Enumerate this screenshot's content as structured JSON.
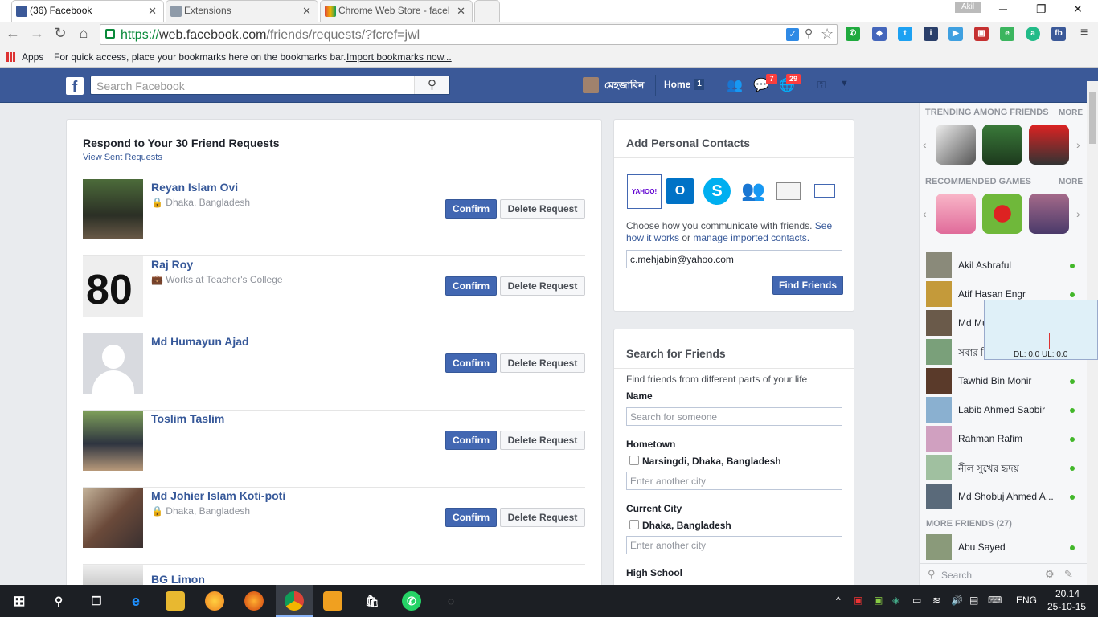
{
  "browser": {
    "tabs": [
      {
        "label": "(36) Facebook",
        "icon": "facebook-icon",
        "active": true
      },
      {
        "label": "Extensions",
        "icon": "puzzle-icon",
        "active": false
      },
      {
        "label": "Chrome Web Store - facel",
        "icon": "chrome-store-icon",
        "active": false
      }
    ],
    "profile_name": "Akil",
    "url_scheme": "https://",
    "url_host": "web.facebook.com",
    "url_path": "/friends/requests/?fcref=jwl",
    "bookmarks": {
      "apps_label": "Apps",
      "hint_text": "For quick access, place your bookmarks here on the bookmarks bar.",
      "import_link": "Import bookmarks now..."
    }
  },
  "fb_header": {
    "search_placeholder": "Search Facebook",
    "user_name": "মেহজাবিন",
    "home_label": "Home",
    "home_count": "1",
    "messages_count": "7",
    "notifications_count": "29",
    "brand_color": "#3b5998"
  },
  "requests": {
    "title": "Respond to Your 30 Friend Requests",
    "sent_link": "View Sent Requests",
    "confirm_label": "Confirm",
    "delete_label": "Delete Request",
    "items": [
      {
        "name": "Reyan Islam Ovi",
        "detail": "Dhaka, Bangladesh"
      },
      {
        "name": "Raj Roy",
        "detail": "Works at Teacher's College"
      },
      {
        "name": "Md Humayun Ajad",
        "detail": ""
      },
      {
        "name": "Toslim Taslim",
        "detail": ""
      },
      {
        "name": "Md Johier Islam Koti-poti",
        "detail": "Dhaka, Bangladesh"
      },
      {
        "name": "BG Limon",
        "detail": ""
      }
    ]
  },
  "contacts": {
    "title": "Add Personal Contacts",
    "desc_prefix": "Choose how you communicate with friends.",
    "desc_link1": "See how it works",
    "desc_or": "or",
    "desc_link2": "manage imported contacts.",
    "email_value": "c.mehjabin@yahoo.com",
    "find_label": "Find Friends",
    "providers": [
      "yahoo-icon",
      "outlook-icon",
      "skype-icon",
      "messenger-icon",
      "contact-card-icon",
      "email-icon"
    ],
    "yahoo_text": "YAHOO!"
  },
  "search_friends": {
    "title": "Search for Friends",
    "subtitle": "Find friends from different parts of your life",
    "name_label": "Name",
    "name_placeholder": "Search for someone",
    "hometown_label": "Hometown",
    "hometown_option": "Narsingdi, Dhaka, Bangladesh",
    "hometown_placeholder": "Enter another city",
    "city_label": "Current City",
    "city_option": "Dhaka, Bangladesh",
    "city_placeholder": "Enter another city",
    "school_label": "High School"
  },
  "sidebar": {
    "trending_title": "TRENDING AMONG FRIENDS",
    "more_label": "MORE",
    "recommended_title": "RECOMMENDED GAMES",
    "friends": [
      {
        "name": "Akil Ashraful"
      },
      {
        "name": "Atif Hasan Engr"
      },
      {
        "name": "Md Mustak Ahmed"
      },
      {
        "name": "সবার প্রিয়"
      },
      {
        "name": "Tawhid Bin Monir"
      },
      {
        "name": "Labib Ahmed Sabbir"
      },
      {
        "name": "Rahman Rafim"
      },
      {
        "name": "নীল সুখের হৃদয়"
      },
      {
        "name": "Md Shobuj Ahmed A..."
      }
    ],
    "more_friends_label": "MORE FRIENDS (27)",
    "more_friends": [
      {
        "name": "Abu Sayed"
      }
    ],
    "chat_search_placeholder": "Search",
    "net_meter_text": "DL: 0.0 UL: 0.0"
  },
  "taskbar": {
    "language": "ENG",
    "time": "20.14",
    "date": "25-10-15"
  }
}
